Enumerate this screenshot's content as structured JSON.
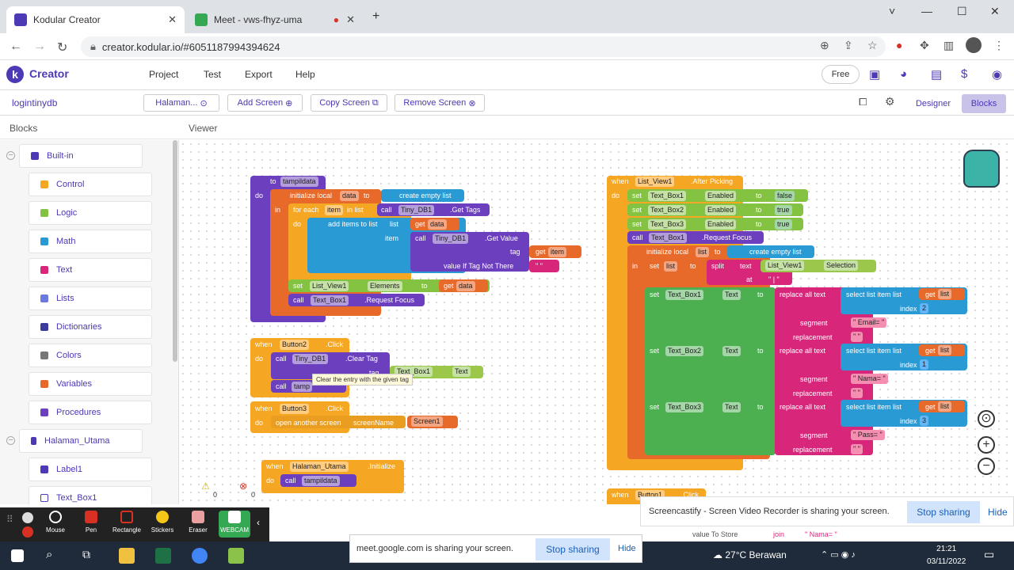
{
  "browser": {
    "tabs": [
      {
        "title": "Kodular Creator",
        "favicon": "kodular-icon",
        "active": true
      },
      {
        "title": "Meet - vws-fhyz-uma",
        "favicon": "meet-icon",
        "active": false
      }
    ],
    "new_tab": "+",
    "url": "creator.kodular.io/#6051187994394624",
    "window_controls": [
      "˅",
      "—",
      "☐",
      "✕"
    ]
  },
  "app": {
    "logo_letter": "k",
    "name": "Creator",
    "menu": [
      "Project",
      "Test",
      "Export",
      "Help"
    ],
    "plan": "Free",
    "brand_color": "#4b39b5"
  },
  "toolbar": {
    "project_name": "logintinydb",
    "screen_select": "Halaman...",
    "add_screen": "Add Screen",
    "copy_screen": "Copy Screen",
    "remove_screen": "Remove Screen",
    "designer": "Designer",
    "blocks": "Blocks"
  },
  "panels": {
    "blocks_title": "Blocks",
    "viewer_title": "Viewer"
  },
  "sidebar": {
    "builtin": "Built-in",
    "items": [
      {
        "label": "Control",
        "color": "#f5a623"
      },
      {
        "label": "Logic",
        "color": "#84c341"
      },
      {
        "label": "Math",
        "color": "#2a9ad4"
      },
      {
        "label": "Text",
        "color": "#d8277b"
      },
      {
        "label": "Lists",
        "color": "#6c7ae0"
      },
      {
        "label": "Dictionaries",
        "color": "#3b3b9e"
      },
      {
        "label": "Colors",
        "color": "#777777"
      },
      {
        "label": "Variables",
        "color": "#e86a2b"
      },
      {
        "label": "Procedures",
        "color": "#6c3fbf"
      }
    ],
    "screen": "Halaman_Utama",
    "components": [
      "Label1",
      "Text_Box1"
    ]
  },
  "blocks": {
    "proc": {
      "to": "to",
      "name": "tampildata",
      "do": "do",
      "init": "initialize local",
      "var": "data",
      "to2": "to",
      "empty": "create empty list",
      "in": "in",
      "foreach": "for each",
      "item": "item",
      "inlist": "in list",
      "call": "call",
      "db": "Tiny_DB1",
      "gettags": ".Get Tags",
      "do2": "do",
      "additems": "add items to list",
      "list": "list",
      "getdata": "get",
      "data2": "data",
      "item2": "item",
      "call2": "call",
      "db2": "Tiny_DB1",
      "getvalue": ".Get Value",
      "tag": "tag",
      "getitem": "get",
      "itemv": "item",
      "notthere": "value If Tag Not There",
      "empty_str": "\" \"",
      "set": "set",
      "lv": "List_View1",
      "elements": "Elements",
      "to3": "to",
      "getd": "get",
      "datav": "data",
      "call3": "call",
      "tb1": "Text_Box1",
      "reqfocus": ".Request Focus"
    },
    "btn2": {
      "when": "when",
      "name": "Button2",
      "event": ".Click",
      "do": "do",
      "call": "call",
      "db": "Tiny_DB1",
      "cleartag": ".Clear Tag",
      "tag": "tag",
      "tb": "Text_Box1",
      "text": "Text",
      "call2": "call",
      "tamp": "tamp",
      "tooltip": "Clear the entry with the given tag"
    },
    "btn3": {
      "when": "when",
      "name": "Button3",
      "event": ".Click",
      "do": "do",
      "open": "open another screen",
      "sn": "screenName",
      "screen": "Screen1"
    },
    "init": {
      "when": "when",
      "name": "Halaman_Utama",
      "event": ".Initialize",
      "do": "do",
      "call": "call",
      "proc": "tampildata"
    },
    "after": {
      "when": "when",
      "name": "List_View1",
      "event": ".After Picking",
      "do": "do",
      "sets": [
        {
          "set": "set",
          "tb": "Text_Box1",
          "prop": "Enabled",
          "to": "to",
          "val": "false"
        },
        {
          "set": "set",
          "tb": "Text_Box2",
          "prop": "Enabled",
          "to": "to",
          "val": "true"
        },
        {
          "set": "set",
          "tb": "Text_Box3",
          "prop": "Enabled",
          "to": "to",
          "val": "true"
        }
      ],
      "call": "call",
      "tb1": "Text_Box1",
      "reqfocus": ".Request Focus",
      "init": "initialize local",
      "listvar": "list",
      "to": "to",
      "empty": "create empty list",
      "in": "in",
      "setl": "set",
      "listv": "list",
      "to2": "to",
      "split": "split",
      "text": "text",
      "lv": "List_View1",
      "selection": "Selection",
      "at": "at",
      "atval": "\" | \"",
      "rows": [
        {
          "set": "set",
          "tb": "Text_Box1",
          "prop": "Text",
          "to": "to",
          "replace": "replace all text",
          "select": "select list item list",
          "get": "get",
          "listv": "list",
          "index": "index",
          "idx": "2",
          "segment": "segment",
          "seg": "\" Email= \"",
          "replacement": "replacement",
          "rep": "\" \""
        },
        {
          "set": "set",
          "tb": "Text_Box2",
          "prop": "Text",
          "to": "to",
          "replace": "replace all text",
          "select": "select list item list",
          "get": "get",
          "listv": "list",
          "index": "index",
          "idx": "1",
          "segment": "segment",
          "seg": "\" Nama= \"",
          "replacement": "replacement",
          "rep": "\" \""
        },
        {
          "set": "set",
          "tb": "Text_Box3",
          "prop": "Text",
          "to": "to",
          "replace": "replace all text",
          "select": "select list item list",
          "get": "get",
          "listv": "list",
          "index": "index",
          "idx": "3",
          "segment": "segment",
          "seg": "\" Pass= \"",
          "replacement": "replacement",
          "rep": "\" \""
        }
      ]
    },
    "btn1": {
      "when": "when",
      "name": "Button1",
      "event": ".Click",
      "do": "do",
      "ca": "ca",
      "valuetostore": "value To Store",
      "join": "join",
      "nama": "\" Nama= \""
    }
  },
  "workspace": {
    "warn_count": "0",
    "err_count": "0"
  },
  "cast": {
    "message": "Screencastify - Screen Video Recorder is sharing your screen.",
    "stop": "Stop sharing",
    "hide": "Hide"
  },
  "annotate": {
    "tools": [
      "Mouse",
      "Pen",
      "Rectangle",
      "Stickers",
      "Eraser",
      "WEBCAM"
    ]
  },
  "meet": {
    "message": "meet.google.com is sharing your screen.",
    "stop": "Stop sharing",
    "hide": "Hide"
  },
  "taskbar": {
    "weather": "27°C  Berawan",
    "time": "21:21",
    "date": "03/11/2022"
  }
}
